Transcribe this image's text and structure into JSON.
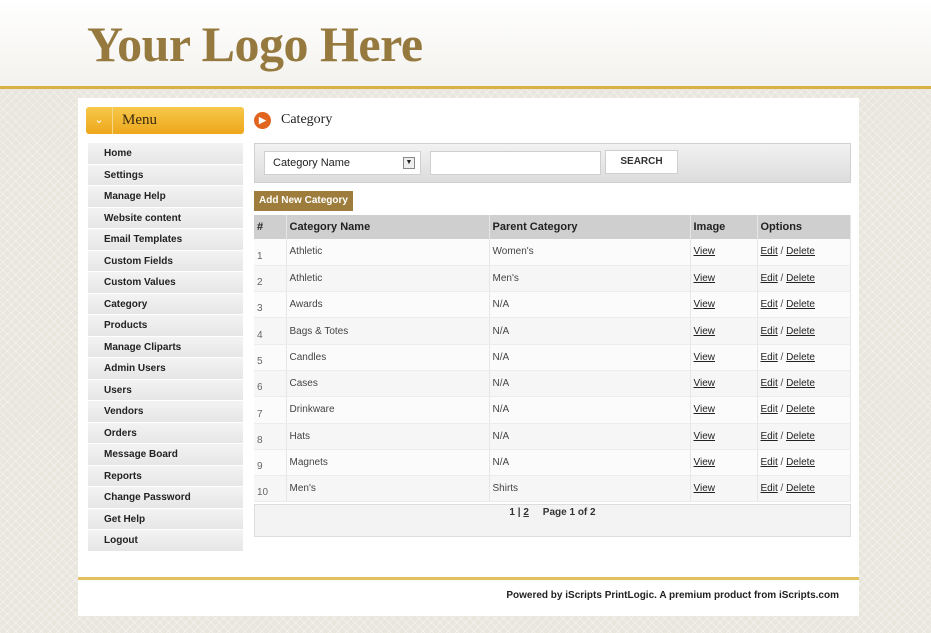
{
  "logo": "Your Logo Here",
  "sidebar": {
    "title": "Menu",
    "items": [
      "Home",
      "Settings",
      "Manage Help",
      "Website content",
      "Email Templates",
      "Custom Fields",
      "Custom Values",
      "Category",
      "Products",
      "Manage Cliparts",
      "Admin Users",
      "Users",
      "Vendors",
      "Orders",
      "Message Board",
      "Reports",
      "Change Password",
      "Get Help",
      "Logout"
    ]
  },
  "main": {
    "title": "Category",
    "search": {
      "field_selected": "Category Name",
      "input_value": "",
      "button_label": "SEARCH"
    },
    "add_button": "Add New Category",
    "columns": [
      "#",
      "Category Name",
      "Parent Category",
      "Image",
      "Options"
    ],
    "rows": [
      {
        "num": "1",
        "name": "Athletic",
        "parent": "Women's",
        "image": "View",
        "edit": "Edit",
        "delete": "Delete"
      },
      {
        "num": "2",
        "name": "Athletic",
        "parent": "Men's",
        "image": "View",
        "edit": "Edit",
        "delete": "Delete"
      },
      {
        "num": "3",
        "name": "Awards",
        "parent": "N/A",
        "image": "View",
        "edit": "Edit",
        "delete": "Delete"
      },
      {
        "num": "4",
        "name": "Bags & Totes",
        "parent": "N/A",
        "image": "View",
        "edit": "Edit",
        "delete": "Delete"
      },
      {
        "num": "5",
        "name": "Candles",
        "parent": "N/A",
        "image": "View",
        "edit": "Edit",
        "delete": "Delete"
      },
      {
        "num": "6",
        "name": "Cases",
        "parent": "N/A",
        "image": "View",
        "edit": "Edit",
        "delete": "Delete"
      },
      {
        "num": "7",
        "name": "Drinkware",
        "parent": "N/A",
        "image": "View",
        "edit": "Edit",
        "delete": "Delete"
      },
      {
        "num": "8",
        "name": "Hats",
        "parent": "N/A",
        "image": "View",
        "edit": "Edit",
        "delete": "Delete"
      },
      {
        "num": "9",
        "name": "Magnets",
        "parent": "N/A",
        "image": "View",
        "edit": "Edit",
        "delete": "Delete"
      },
      {
        "num": "10",
        "name": "Men's",
        "parent": "Shirts",
        "image": "View",
        "edit": "Edit",
        "delete": "Delete"
      }
    ],
    "pager": {
      "page1": "1",
      "separator": "|",
      "page2": "2",
      "info": "Page 1 of 2"
    }
  },
  "footer": "Powered by iScripts PrintLogic. A premium product from iScripts.com",
  "colors": {
    "accent": "#9e7d3c",
    "menu_header": "#eda71b",
    "title_icon": "#e1651f",
    "logo": "#96793e"
  }
}
